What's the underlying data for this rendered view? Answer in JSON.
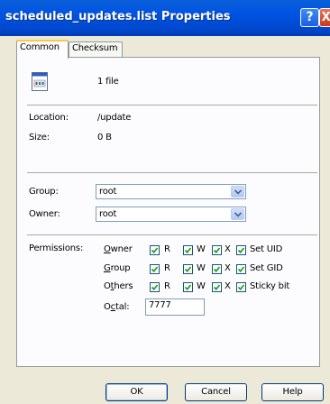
{
  "window": {
    "title": "scheduled_updates.list Properties"
  },
  "titlebar": {
    "help": "?",
    "close": "X"
  },
  "tabs": [
    {
      "label": "Common"
    },
    {
      "label": "Checksum"
    }
  ],
  "summary": {
    "file_count": "1 file"
  },
  "info": {
    "location_label": "Location:",
    "location_value": "/update",
    "size_label": "Size:",
    "size_value": "0 B"
  },
  "group": {
    "label": "Group:",
    "value": "root"
  },
  "owner": {
    "label": "Owner:",
    "value": "root"
  },
  "permissions": {
    "label": "Permissions:",
    "rows": [
      {
        "name": "Owner",
        "r": "R",
        "w": "W",
        "x": "X",
        "extra": "Set UID"
      },
      {
        "name": "Group",
        "r": "R",
        "w": "W",
        "x": "X",
        "extra": "Set GID"
      },
      {
        "name": "Others",
        "r": "R",
        "w": "W",
        "x": "X",
        "extra": "Sticky bit"
      }
    ],
    "octal_label": "Octal:",
    "octal_value": "7777"
  },
  "buttons": {
    "ok": "OK",
    "cancel": "Cancel",
    "help": "Help"
  }
}
